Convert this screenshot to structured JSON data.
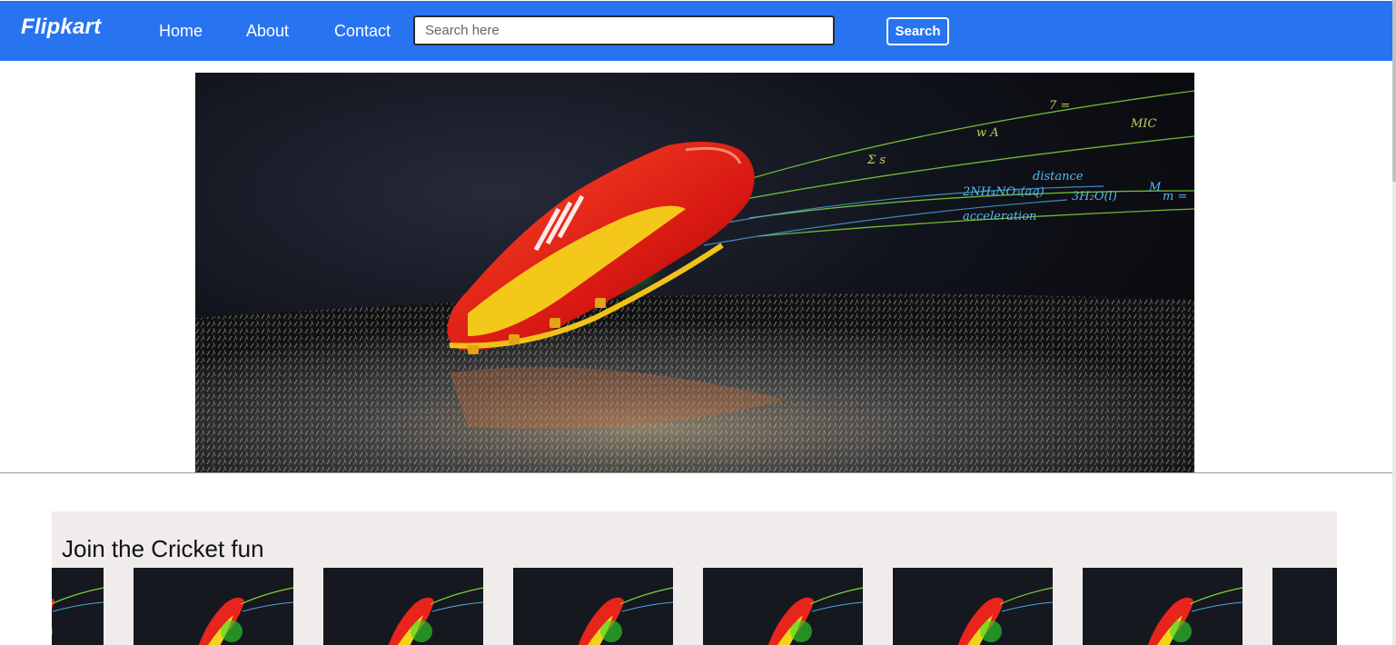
{
  "navbar": {
    "brand": "Flipkart",
    "links": [
      "Home",
      "About",
      "Contact"
    ],
    "search_placeholder": "Search here",
    "search_button": "Search"
  },
  "hero": {
    "formula_texts": [
      "2NH₄NO₃(aq)",
      "3H₂O(l)",
      "distance",
      "acceleration",
      "m =",
      "M",
      "MIC"
    ]
  },
  "section": {
    "title": "Join the Cricket fun",
    "card_count": 8
  },
  "colors": {
    "navbar": "#2874f0",
    "section_bg": "#efeceb",
    "accent_shoe": "#e8241c",
    "accent_stripe": "#f4d21a"
  }
}
